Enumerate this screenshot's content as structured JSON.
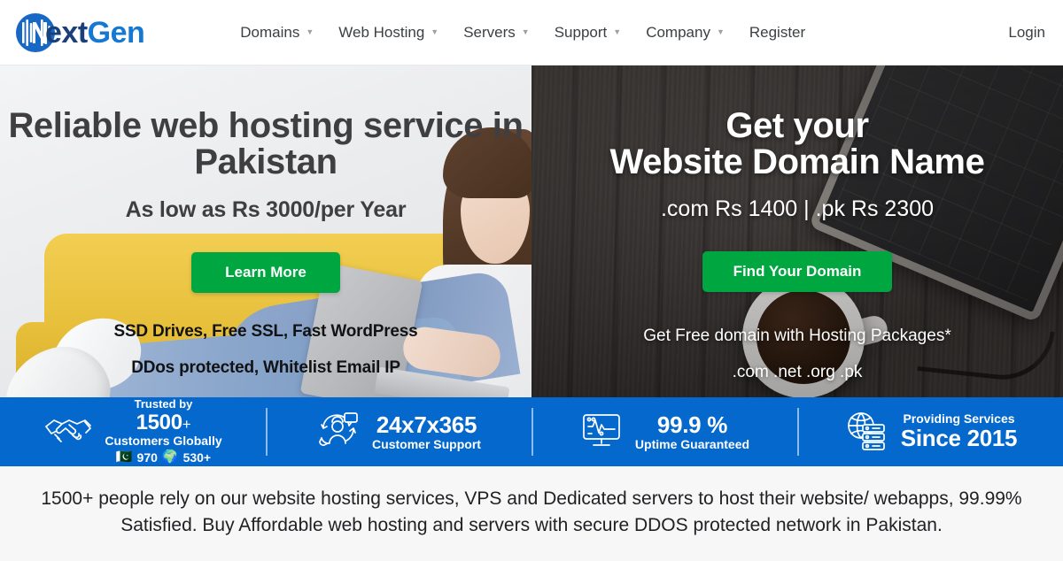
{
  "brand": {
    "name_part1": "ext",
    "name_part2": "Gen",
    "logo_icon": "nextgen-circle-n-logo",
    "color_dark": "#1b3f7a",
    "color_accent": "#1478d4"
  },
  "nav": {
    "items": [
      {
        "label": "Domains",
        "has_dropdown": true
      },
      {
        "label": "Web Hosting",
        "has_dropdown": true
      },
      {
        "label": "Servers",
        "has_dropdown": true
      },
      {
        "label": "Support",
        "has_dropdown": true
      },
      {
        "label": "Company",
        "has_dropdown": true
      },
      {
        "label": "Register",
        "has_dropdown": false
      }
    ],
    "login_label": "Login",
    "caret_glyph": "▼"
  },
  "hero": {
    "left": {
      "title": "Reliable web hosting service in Pakistan",
      "subtitle": "As low as Rs 3000/per Year",
      "cta_label": "Learn More",
      "cta_color": "#00a63f",
      "feature_1": "SSD Drives, Free SSL, Fast WordPress",
      "feature_2": "DDos protected, Whitelist Email IP"
    },
    "right": {
      "title_line1": "Get your",
      "title_line2": "Website Domain Name",
      "subtitle": ".com Rs 1400 | .pk Rs 2300",
      "cta_label": "Find Your Domain",
      "cta_color": "#00a63f",
      "note_1": "Get Free domain with Hosting Packages*",
      "note_2": ".com .net .org .pk"
    }
  },
  "stats_bar": {
    "background": "#0568cd",
    "items": [
      {
        "icon": "handshake-icon",
        "top_label": "Trusted by",
        "value": "1500",
        "value_suffix": "+",
        "sub_label": "Customers Globally",
        "flag_emoji": "🇵🇰",
        "flag_count": "970",
        "globe_emoji": "🌍",
        "globe_count": "530+"
      },
      {
        "icon": "customer-support-headset-icon",
        "value": "24x7x365",
        "sub_label": "Customer Support"
      },
      {
        "icon": "monitor-pulse-uptime-icon",
        "value": "99.9 %",
        "sub_label": "Uptime Guaranteed"
      },
      {
        "icon": "globe-server-rack-icon",
        "top_label": "Providing Services",
        "value": "Since 2015"
      }
    ]
  },
  "blurb": {
    "text": "1500+ people rely on our website hosting services, VPS and Dedicated servers to host their website/ webapps, 99.99% Satisfied. Buy Affordable web hosting and servers with secure DDOS protected network in Pakistan."
  }
}
